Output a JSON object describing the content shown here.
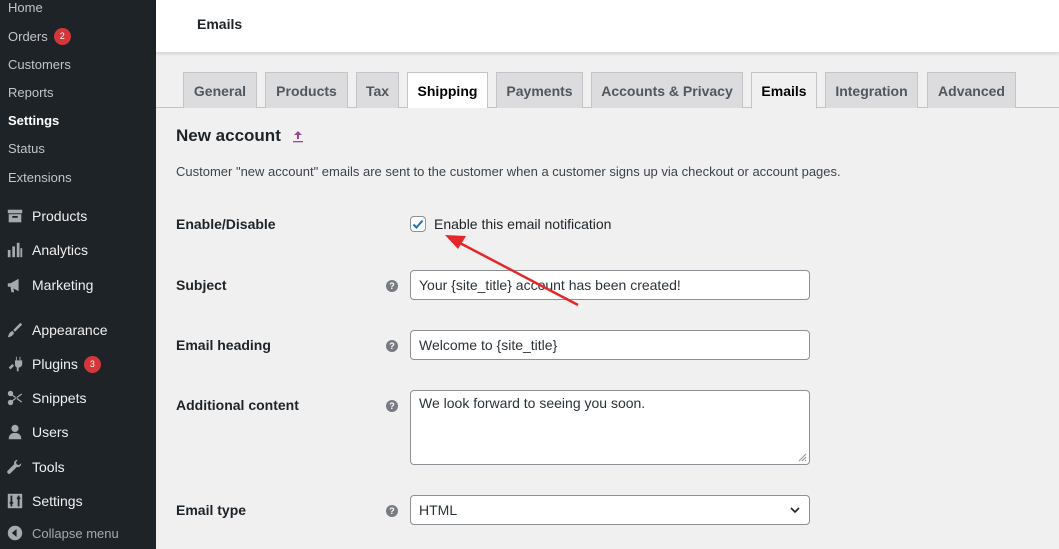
{
  "sidebar": {
    "submenu": [
      {
        "label": "Home"
      },
      {
        "label": "Orders",
        "badge": "2"
      },
      {
        "label": "Customers"
      },
      {
        "label": "Reports"
      },
      {
        "label": "Settings"
      },
      {
        "label": "Status"
      },
      {
        "label": "Extensions"
      }
    ],
    "menu": [
      {
        "label": "Products",
        "icon": "archive-icon"
      },
      {
        "label": "Analytics",
        "icon": "bar-chart-icon"
      },
      {
        "label": "Marketing",
        "icon": "megaphone-icon"
      },
      {
        "label": "Appearance",
        "icon": "paintbrush-icon"
      },
      {
        "label": "Plugins",
        "icon": "plug-icon",
        "badge": "3"
      },
      {
        "label": "Snippets",
        "icon": "scissors-icon"
      },
      {
        "label": "Users",
        "icon": "user-icon"
      },
      {
        "label": "Tools",
        "icon": "wrench-icon"
      },
      {
        "label": "Settings",
        "icon": "sliders-icon"
      }
    ],
    "collapse_label": "Collapse menu"
  },
  "header": {
    "title": "Emails"
  },
  "tabs": [
    "General",
    "Products",
    "Tax",
    "Shipping",
    "Payments",
    "Accounts & Privacy",
    "Emails",
    "Integration",
    "Advanced"
  ],
  "active_tab": "Emails",
  "content": {
    "title": "New account",
    "description": "Customer \"new account\" emails are sent to the customer when a customer signs up via checkout or account pages.",
    "enable": {
      "label": "Enable/Disable",
      "checkbox_label": "Enable this email notification",
      "checked": true
    },
    "subject": {
      "label": "Subject",
      "value": "Your {site_title} account has been created!"
    },
    "heading": {
      "label": "Email heading",
      "value": "Welcome to {site_title}"
    },
    "additional": {
      "label": "Additional content",
      "value": "We look forward to seeing you soon."
    },
    "email_type": {
      "label": "Email type",
      "value": "HTML"
    }
  },
  "colors": {
    "accent": "#2271b1",
    "badge": "#d63638",
    "sidebar": "#1d2327",
    "annotation_arrow": "#e5262a"
  }
}
